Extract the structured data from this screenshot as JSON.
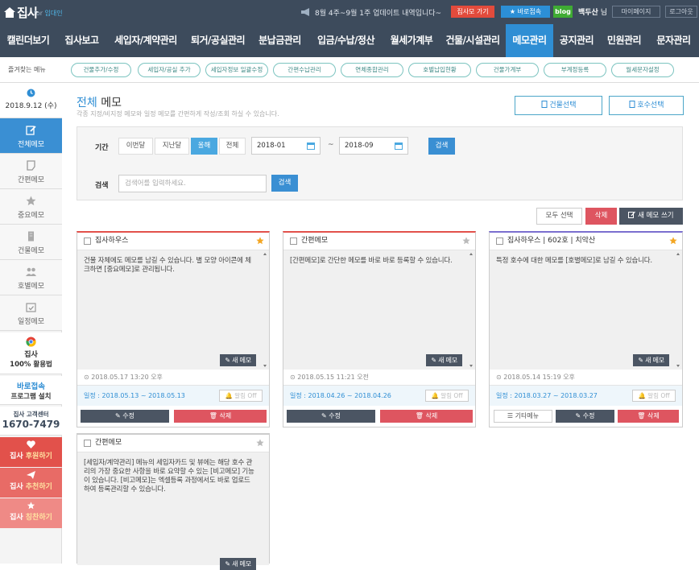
{
  "header": {
    "logo_text": "집사",
    "logo_for": "for",
    "logo_sub": "임대인",
    "notice": "8월 4주~9월 1주 업데이트 내역입니다~",
    "btn_guide": "집사모 가기",
    "btn_quick": "★ 바로접속",
    "btn_blog": "blog",
    "user_name": "백두산",
    "user_suffix": "님",
    "mypage": "마이페이지",
    "logout": "로그아웃"
  },
  "nav": {
    "items": [
      "캘린더보기",
      "집사보고",
      "세입자/계약관리",
      "퇴거/공실관리",
      "분납금관리",
      "입금/수납/정산",
      "월세가계부",
      "건물/시설관리",
      "메모관리",
      "공지관리",
      "민원관리",
      "문자관리"
    ],
    "active_index": 8
  },
  "quick": {
    "label": "즐겨찾는 메뉴",
    "items": [
      "건물추가/수정",
      "세입자/공실 추가",
      "세입자정보 일괄수정",
      "간편수납관리",
      "연체종합관리",
      "호별납입현황",
      "건물가계부",
      "부계정등록",
      "월세문자설정"
    ]
  },
  "sidebar": {
    "date": "2018.9.12 (수)",
    "items": [
      {
        "label": "전체메모",
        "icon": "edit-icon",
        "active": true
      },
      {
        "label": "간편메모",
        "icon": "note-icon",
        "active": false
      },
      {
        "label": "중요메모",
        "icon": "star-icon",
        "active": false
      },
      {
        "label": "건물메모",
        "icon": "building-icon",
        "active": false
      },
      {
        "label": "호별메모",
        "icon": "people-icon",
        "active": false
      },
      {
        "label": "일정메모",
        "icon": "calendar-check-icon",
        "active": false
      }
    ],
    "chrome_line1": "집사",
    "chrome_line2": "100% 활용법",
    "remote_title": "바로접속",
    "remote_sub": "프로그램 설치",
    "cs_label": "집사 고객센터",
    "cs_phone": "1670-7479",
    "promo": [
      {
        "pre": "집사",
        "em": "후원하기"
      },
      {
        "pre": "집사",
        "em": "추천하기"
      },
      {
        "pre": "집사",
        "em": "칭찬하기"
      }
    ]
  },
  "page": {
    "title_em": "전체",
    "title_rest": "메모",
    "subtitle": "각종 지정/비지정 메모와 일정 메모를 간편하게 작성/조회 하실 수 있습니다.",
    "btn_building": "건물선택",
    "btn_unit": "호수선택"
  },
  "filter": {
    "period_label": "기간",
    "periods": [
      "이번달",
      "지난달",
      "올해",
      "전체"
    ],
    "active_period": 2,
    "date_from": "2018-01",
    "tilde": "~",
    "date_to": "2018-09",
    "search_btn": "검색",
    "keyword_label": "검색",
    "keyword_placeholder": "검색어를 입력하세요.",
    "keyword_btn": "검색"
  },
  "actions": {
    "select_all": "모두 선택",
    "delete": "삭제",
    "new_memo": "새 메모 쓰기"
  },
  "memos": [
    {
      "title": "집사하우스",
      "body": "건물 자체에도 메모를 남길 수 있습니다. 별 모양 아이콘에 체크하면 [중요메모]로 관리됩니다.",
      "starred": true,
      "accent": "#e2514b",
      "new_memo": "새 메모",
      "time": "2018.05.17 13:20 오후",
      "schedule": "일정 : 2018.05.13 ~ 2018.05.13",
      "alarm": "알림 Off",
      "edit": "수정",
      "delete": "삭제"
    },
    {
      "title": "간편메모",
      "body": "[간편메모]로 간단한 메모를 바로 바로 등록할 수 있습니다.",
      "starred": false,
      "accent": "#e2514b",
      "new_memo": "새 메모",
      "time": "2018.05.15 11:21 오전",
      "schedule": "일정 : 2018.04.26 ~ 2018.04.26",
      "alarm": "알림 Off",
      "edit": "수정",
      "delete": "삭제"
    },
    {
      "title": "집사하우스 | 602호 | 치악산",
      "body": "특정 호수에 대한 메모를 [호별메모]로 남길 수 있습니다.",
      "starred": true,
      "accent": "#7b6fcf",
      "new_memo": "새 메모",
      "time": "2018.05.14 15:19 오후",
      "schedule": "일정 : 2018.03.27 ~ 2018.03.27",
      "alarm": "알림 Off",
      "other": "기타메뉴",
      "edit": "수정",
      "delete": "삭제"
    },
    {
      "title": "간편메모",
      "body": "[세입자/계약관리] 메뉴의 세입자카드 및 뷰에는 해당 호수 관리의 가장 중요한 사항을 바로 요약할 수 있는 [비고메모] 기능이 있습니다. [비고메모]는 엑셀등록 과정에서도 바로 업로드하여 등록관리할 수 있습니다.",
      "starred": false,
      "accent": "#cccccc",
      "new_memo": "새 메모"
    }
  ]
}
